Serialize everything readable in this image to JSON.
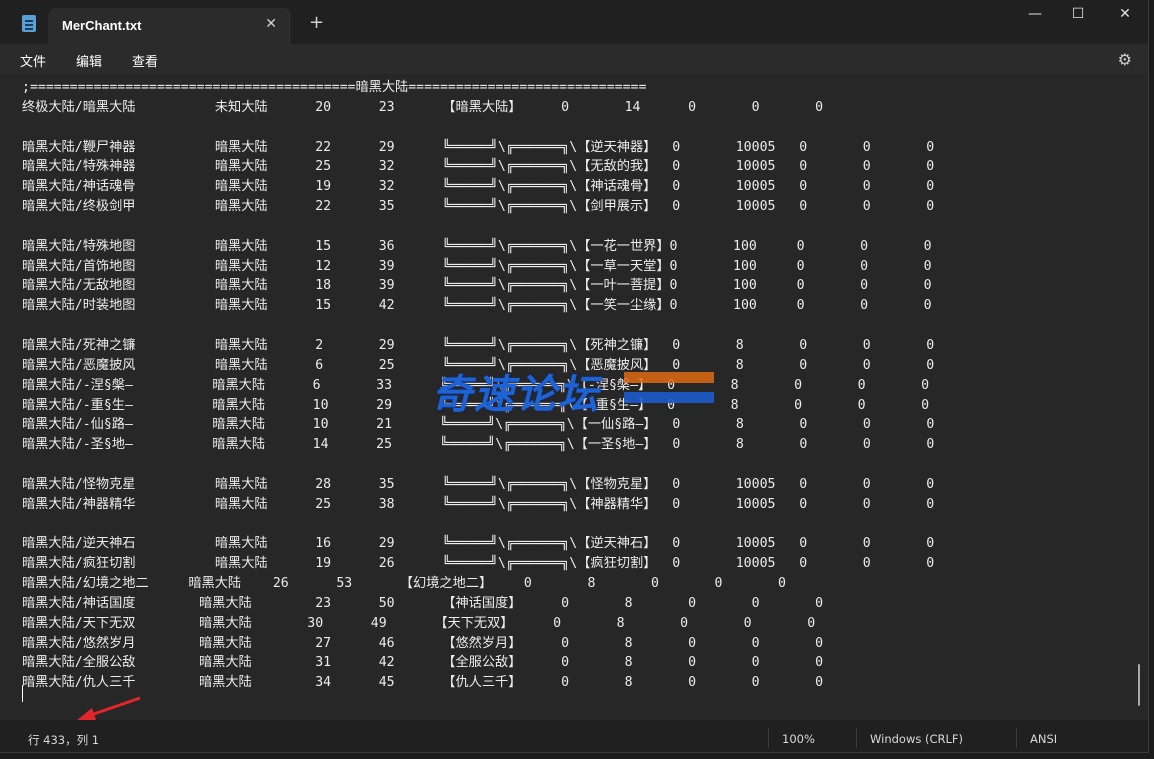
{
  "tab": {
    "title": "MerChant.txt",
    "close": "✕",
    "new": "+"
  },
  "window_controls": {
    "minimize": "—",
    "maximize": "☐",
    "close": "✕"
  },
  "menu": {
    "file": "文件",
    "edit": "编辑",
    "view": "查看",
    "settings_icon": "gear-icon"
  },
  "lines": [
    ";=========================================暗黑大陆==============================",
    "终极大陆/暗黑大陆          未知大陆      20      23      【暗黑大陆】     0       14      0       0       0",
    "",
    "暗黑大陆/鞭尸神器          暗黑大陆      22      29      ╚═════╝\\╔══════╗\\【逆天神器】  0       10005   0       0       0",
    "暗黑大陆/特殊神器          暗黑大陆      25      32      ╚═════╝\\╔══════╗\\【无敌的我】  0       10005   0       0       0",
    "暗黑大陆/神话魂骨          暗黑大陆      19      32      ╚═════╝\\╔══════╗\\【神话魂骨】  0       10005   0       0       0",
    "暗黑大陆/终极剑甲          暗黑大陆      22      35      ╚═════╝\\╔══════╗\\【剑甲展示】  0       10005   0       0       0",
    "",
    "暗黑大陆/特殊地图          暗黑大陆      15      36      ╚═════╝\\╔══════╗\\【一花一世界】0       100     0       0       0",
    "暗黑大陆/首饰地图          暗黑大陆      12      39      ╚═════╝\\╔══════╗\\【一草一天堂】0       100     0       0       0",
    "暗黑大陆/无敌地图          暗黑大陆      18      39      ╚═════╝\\╔══════╗\\【一叶一菩提】0       100     0       0       0",
    "暗黑大陆/时装地图          暗黑大陆      15      42      ╚═════╝\\╔══════╗\\【一笑一尘缘】0       100     0       0       0",
    "",
    "暗黑大陆/死神之镰          暗黑大陆      2       29      ╚═════╝\\╔══════╗\\【死神之镰】  0       8       0       0       0",
    "暗黑大陆/恶魔披风          暗黑大陆      6       25      ╚═════╝\\╔══════╗\\【恶魔披风】  0       8       0       0       0",
    "暗黑大陆/-涅§槃—          暗黑大陆      6       33      ╚═════╝\\╔══════╗\\【-涅§槃—】  0       8       0       0       0",
    "暗黑大陆/-重§生—          暗黑大陆      10      29      ╚═════╝\\╔══════╗\\【-重§生—】  0       8       0       0       0",
    "暗黑大陆/-仙§路—          暗黑大陆      10      21      ╚═════╝\\╔══════╗\\【一仙§路—】  0       8       0       0       0",
    "暗黑大陆/-圣§地—          暗黑大陆      14      25      ╚═════╝\\╔══════╗\\【一圣§地—】  0       8       0       0       0",
    "",
    "暗黑大陆/怪物克星          暗黑大陆      28      35      ╚═════╝\\╔══════╗\\【怪物克星】  0       10005   0       0       0",
    "暗黑大陆/神器精华          暗黑大陆      25      38      ╚═════╝\\╔══════╗\\【神器精华】  0       10005   0       0       0",
    "",
    "暗黑大陆/逆天神石          暗黑大陆      16      29      ╚═════╝\\╔══════╗\\【逆天神石】  0       10005   0       0       0",
    "暗黑大陆/疯狂切割          暗黑大陆      19      26      ╚═════╝\\╔══════╗\\【疯狂切割】  0       10005   0       0       0",
    "暗黑大陆/幻境之地二     暗黑大陆    26      53      【幻境之地二】    0       8       0       0       0",
    "暗黑大陆/神话国度        暗黑大陆        23      50      【神话国度】     0       8       0       0       0",
    "暗黑大陆/天下无双        暗黑大陆       30      49      【天下无双】     0       8       0       0       0",
    "暗黑大陆/悠然岁月        暗黑大陆        27      46      【悠然岁月】     0       8       0       0       0",
    "暗黑大陆/全服公敌        暗黑大陆        31      42      【全服公敌】     0       8       0       0       0",
    "暗黑大陆/仇人三千        暗黑大陆        34      45      【仇人三千】     0       8       0       0       0"
  ],
  "watermark": "奇速论坛",
  "status": {
    "position": "行 433，列 1",
    "zoom": "100%",
    "line_ending": "Windows (CRLF)",
    "encoding": "ANSI"
  }
}
